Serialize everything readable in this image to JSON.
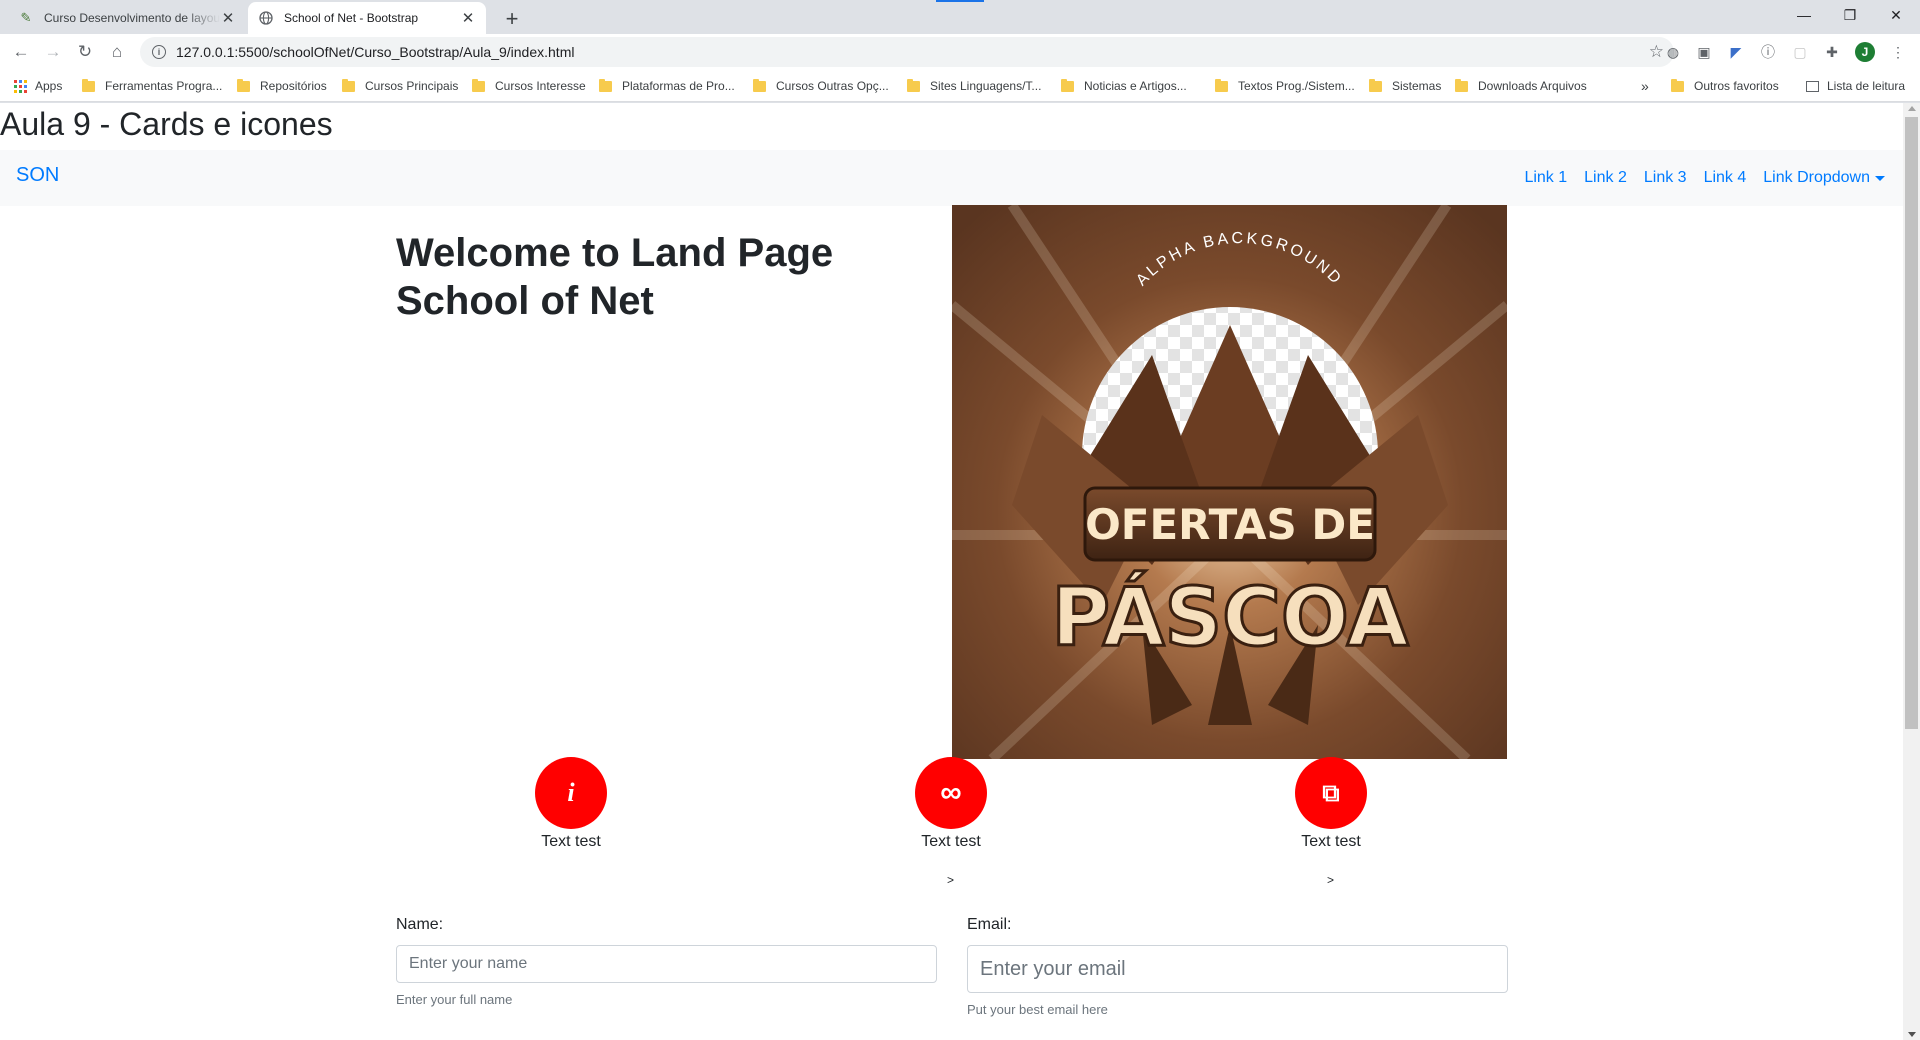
{
  "browser": {
    "tabs": [
      {
        "title": "Curso Desenvolvimento de layout",
        "active": false
      },
      {
        "title": "School of Net - Bootstrap",
        "active": true
      }
    ],
    "url": "127.0.0.1:5500/schoolOfNet/Curso_Bootstrap/Aula_9/index.html",
    "profile_initial": "J",
    "bookmarks": [
      {
        "label": "Apps",
        "icon": "apps-grid-icon"
      },
      {
        "label": "Ferramentas Progra...",
        "icon": "folder-icon"
      },
      {
        "label": "Repositórios",
        "icon": "folder-icon"
      },
      {
        "label": "Cursos Principais",
        "icon": "folder-icon"
      },
      {
        "label": "Cursos Interesse",
        "icon": "folder-icon"
      },
      {
        "label": "Plataformas de Pro...",
        "icon": "folder-icon"
      },
      {
        "label": "Cursos Outras Opç...",
        "icon": "folder-icon"
      },
      {
        "label": "Sites Linguagens/T...",
        "icon": "folder-icon"
      },
      {
        "label": "Noticias e Artigos...",
        "icon": "folder-icon"
      },
      {
        "label": "Textos Prog./Sistem...",
        "icon": "folder-icon"
      },
      {
        "label": "Sistemas",
        "icon": "folder-icon"
      },
      {
        "label": "Downloads Arquivos",
        "icon": "folder-icon"
      }
    ],
    "bookmarks_overflow": "»",
    "other_bookmarks": "Outros favoritos",
    "reading_list": "Lista de leitura"
  },
  "page": {
    "heading": "Aula 9 - Cards e icones",
    "navbar": {
      "brand": "SON",
      "links": [
        "Link 1",
        "Link 2",
        "Link 3",
        "Link 4"
      ],
      "dropdown": "Link Dropdown"
    },
    "hero": {
      "title": "Welcome to Land Page School of Net",
      "image": {
        "arc_text": "ALPHA BACKGROUND",
        "line1": "OFERTAS DE",
        "line2": "PÁSCOA"
      }
    },
    "features": [
      {
        "icon": "info-icon",
        "glyph": "i",
        "text": "Text test"
      },
      {
        "icon": "infinity-icon",
        "glyph": "∞",
        "text": "Text test"
      },
      {
        "icon": "clone-icon",
        "glyph": "⧉",
        "text": "Text test"
      }
    ],
    "stray_marks": [
      ">",
      ">"
    ],
    "form": {
      "name_label": "Name:",
      "name_placeholder": "Enter your name",
      "name_help": "Enter your full name",
      "email_label": "Email:",
      "email_placeholder": "Enter your email",
      "email_help": "Put your best email here"
    }
  },
  "colors": {
    "link": "#007bff",
    "feature_circle": "#ff0000",
    "navbar_bg": "#f8f9fa",
    "tabstrip_bg": "#dee1e6"
  }
}
